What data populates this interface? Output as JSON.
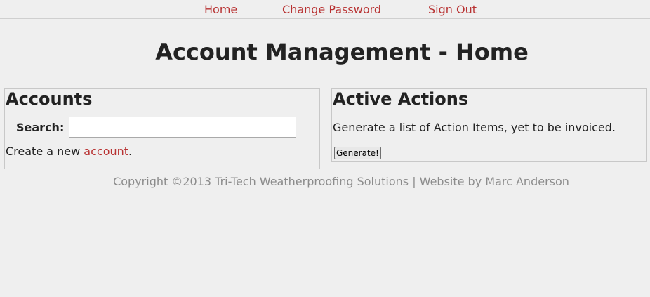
{
  "nav": {
    "home": "Home",
    "change_password": "Change Password",
    "sign_out": "Sign Out"
  },
  "page_title": "Account Management - Home",
  "accounts": {
    "heading": "Accounts",
    "search_label": "Search:",
    "search_value": "",
    "create_prefix": "Create a new ",
    "create_link": "account",
    "create_suffix": "."
  },
  "actions": {
    "heading": "Active Actions",
    "description": "Generate a list of Action Items, yet to be invoiced.",
    "generate_button": "Generate!"
  },
  "footer": "Copyright ©2013 Tri-Tech Weatherproofing Solutions | Website by Marc Anderson",
  "colors": {
    "link": "#b83232",
    "background": "#efefef",
    "footer_text": "#8c8c8c"
  }
}
